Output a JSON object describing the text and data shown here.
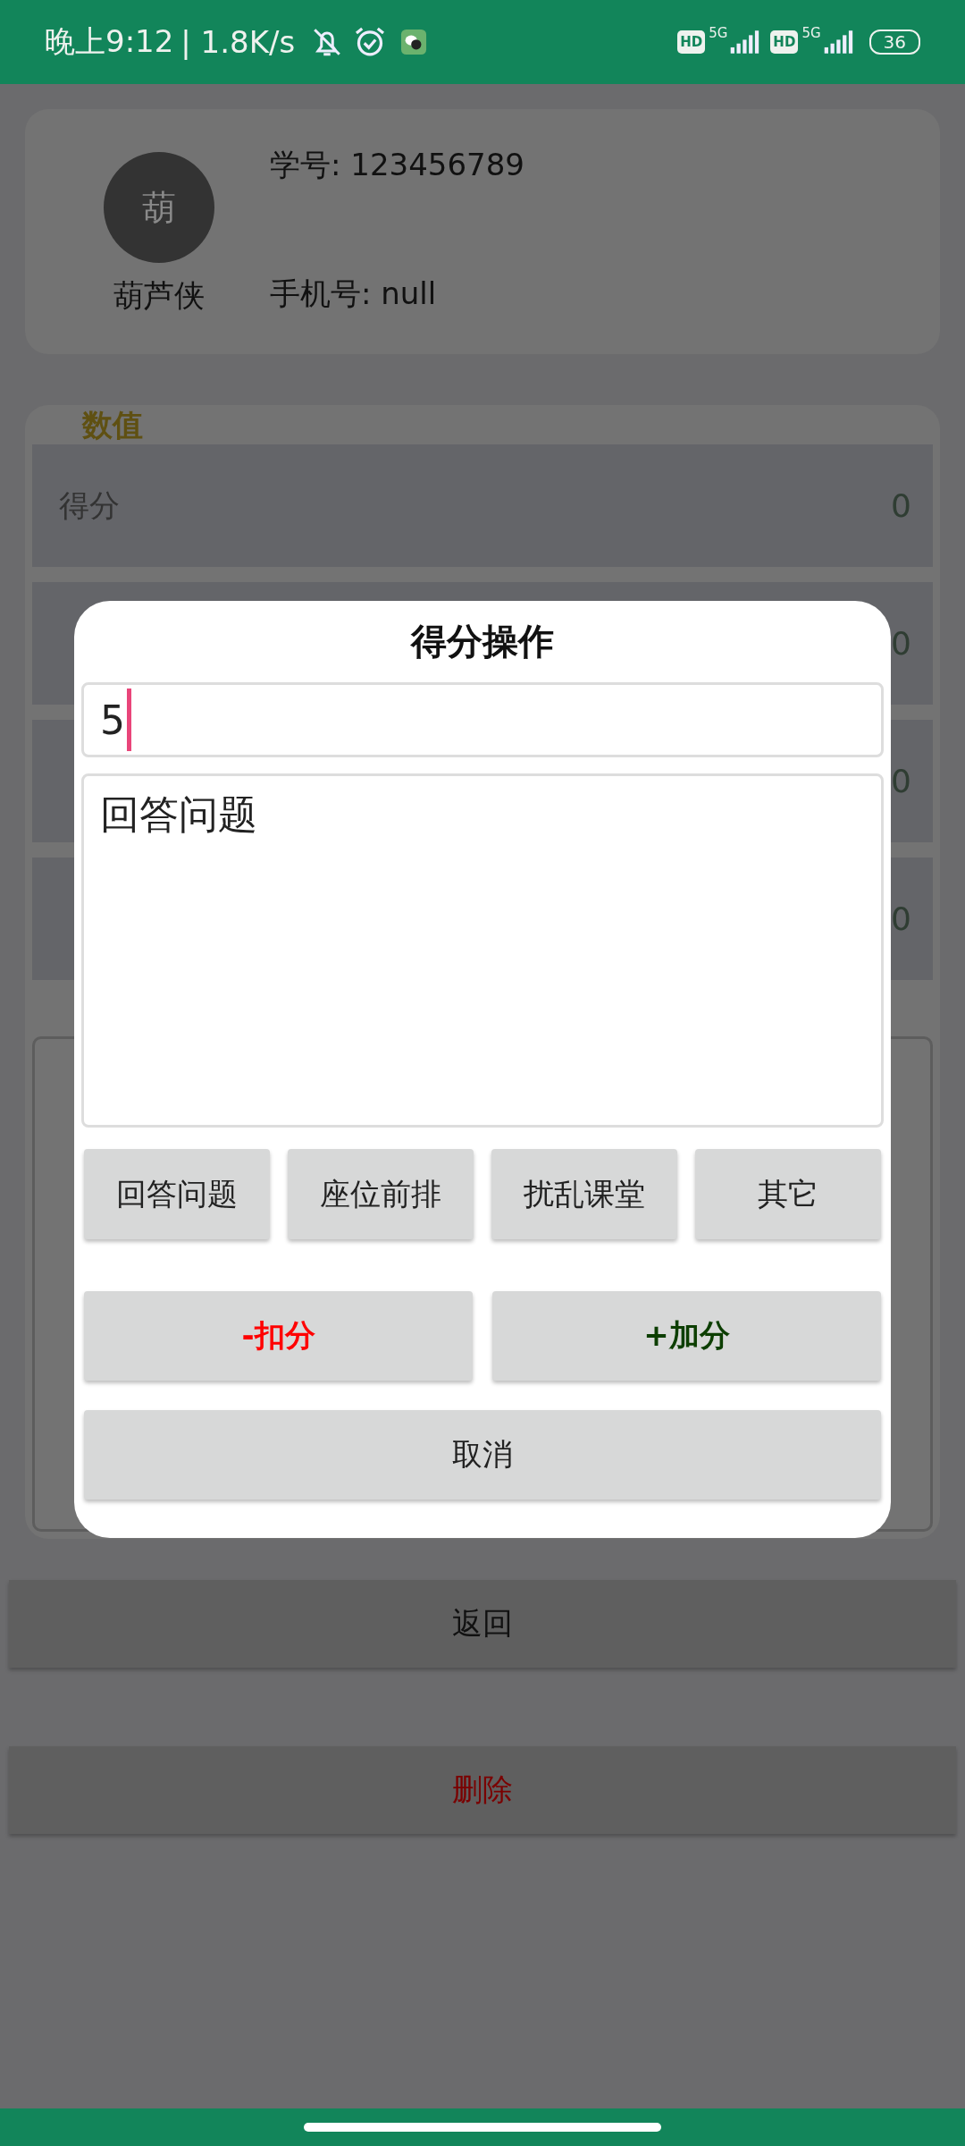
{
  "status_bar": {
    "time": "晚上9:12",
    "speed": "| 1.8K/s",
    "sim_badges": [
      {
        "hd": "HD",
        "network": "5G"
      },
      {
        "hd": "HD",
        "network": "5G"
      }
    ],
    "battery": "36"
  },
  "profile": {
    "avatar": "葫",
    "name": "葫芦侠",
    "student_id": "学号: 123456789",
    "phone": "手机号: null"
  },
  "stats": {
    "title": "数值",
    "rows": [
      {
        "label": "得分",
        "value": "0"
      },
      {
        "value": "0"
      },
      {
        "value": "0"
      },
      {
        "value": "0"
      }
    ]
  },
  "dialog": {
    "title": "得分操作",
    "score": "5",
    "reason": "回答问题",
    "presets": [
      "回答问题",
      "座位前排",
      "扰乱课堂",
      "其它"
    ],
    "actions": [
      {
        "label": "-扣分",
        "kind": "minus"
      },
      {
        "label": "+加分",
        "kind": "plus"
      }
    ],
    "cancel": "取消"
  },
  "buttons": [
    {
      "label": "返回",
      "kind": "normal"
    },
    {
      "label": "删除",
      "kind": "danger"
    }
  ]
}
